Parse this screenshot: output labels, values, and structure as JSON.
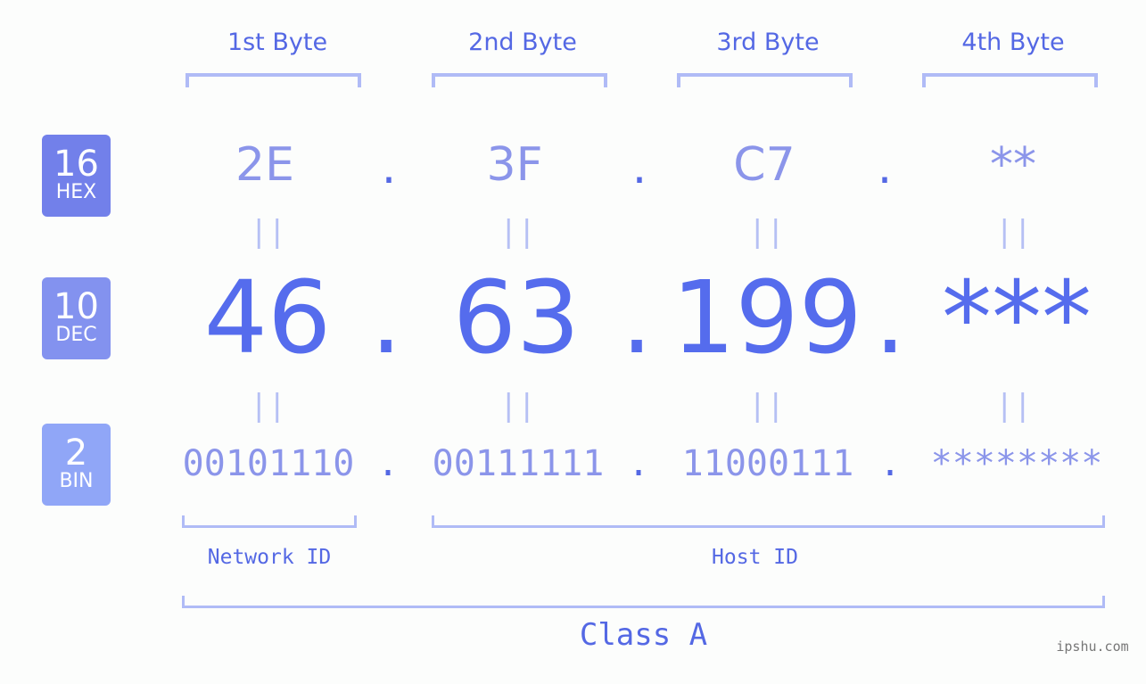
{
  "bytes": {
    "labels": [
      "1st Byte",
      "2nd Byte",
      "3rd Byte",
      "4th Byte"
    ]
  },
  "badges": {
    "hex": {
      "number": "16",
      "label": "HEX",
      "color": "#7280ea"
    },
    "dec": {
      "number": "10",
      "label": "DEC",
      "color": "#8392ef"
    },
    "bin": {
      "number": "2",
      "label": "BIN",
      "color": "#90a6f7"
    }
  },
  "hex": {
    "values": [
      "2E",
      "3F",
      "C7",
      "**"
    ],
    "separator": "."
  },
  "dec": {
    "values": [
      "46",
      "63",
      "199",
      "***"
    ],
    "separator": "."
  },
  "bin": {
    "values": [
      "00101110",
      "00111111",
      "11000111",
      "********"
    ],
    "separator": "."
  },
  "equals_symbol": "||",
  "segments": {
    "network_label": "Network ID",
    "host_label": "Host ID",
    "class_label": "Class A"
  },
  "watermark": "ipshu.com",
  "colors": {
    "accent": "#556ced",
    "light": "#8b95ea",
    "bracket": "#b0bbf6"
  }
}
